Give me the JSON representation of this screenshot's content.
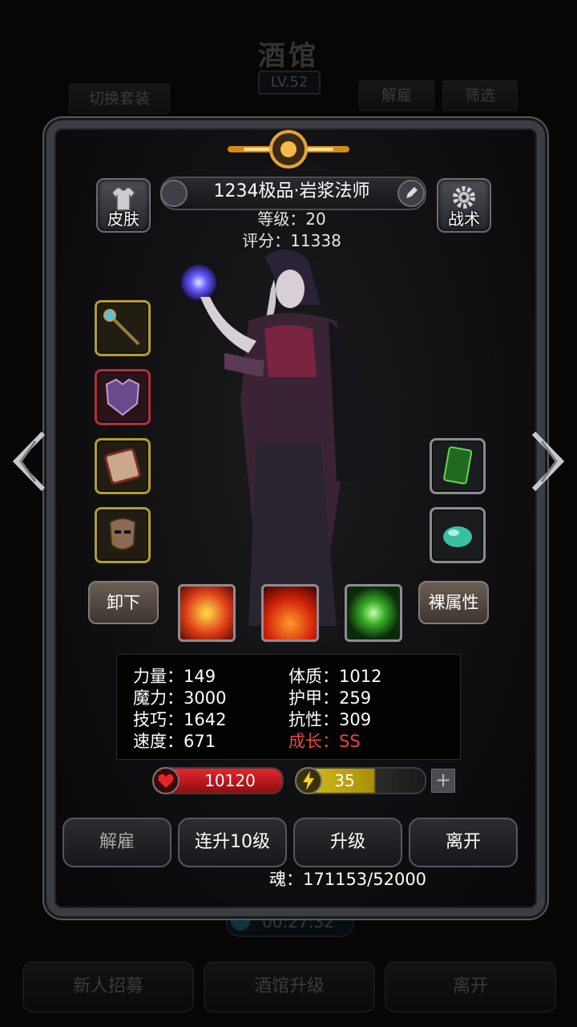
{
  "background": {
    "title": "酒馆",
    "level": "LV.52",
    "switch_outfit": "切换套装",
    "dismiss": "解雇",
    "filter": "筛选",
    "timer": "00:27:32",
    "bottom_buttons": [
      "新人招募",
      "酒馆升级",
      "离开"
    ]
  },
  "hero": {
    "name": "1234极品·岩浆法师",
    "level": "等级：20",
    "score": "评分：11338",
    "skin_label": "皮肤",
    "tactics_label": "战术",
    "unequip_label": "卸下",
    "base_attr_label": "裸属性"
  },
  "equipment_left": [
    "staff-icon",
    "armor-icon",
    "scroll-icon",
    "mask-icon"
  ],
  "equipment_right": [
    "card-icon",
    "gem-icon"
  ],
  "skills": [
    "fire-burst-icon",
    "flame-icon",
    "green-flame-icon"
  ],
  "stats": {
    "left": [
      "力量：149",
      "魔力：3000",
      "技巧：1642",
      "速度：671"
    ],
    "right": [
      "体质：1012",
      "护甲：259",
      "抗性：309"
    ],
    "growth": "成长：SS"
  },
  "bars": {
    "hp": "10120",
    "energy": "35",
    "plus": "+"
  },
  "actions": [
    "解雇",
    "连升10级",
    "升级",
    "离开"
  ],
  "soul": "魂：171153/52000",
  "colors": {
    "growth_red": "#e8473e",
    "hp_red": "#d9222a",
    "energy_yellow": "#d9c21a",
    "gold_slot": "#b59b2c"
  }
}
